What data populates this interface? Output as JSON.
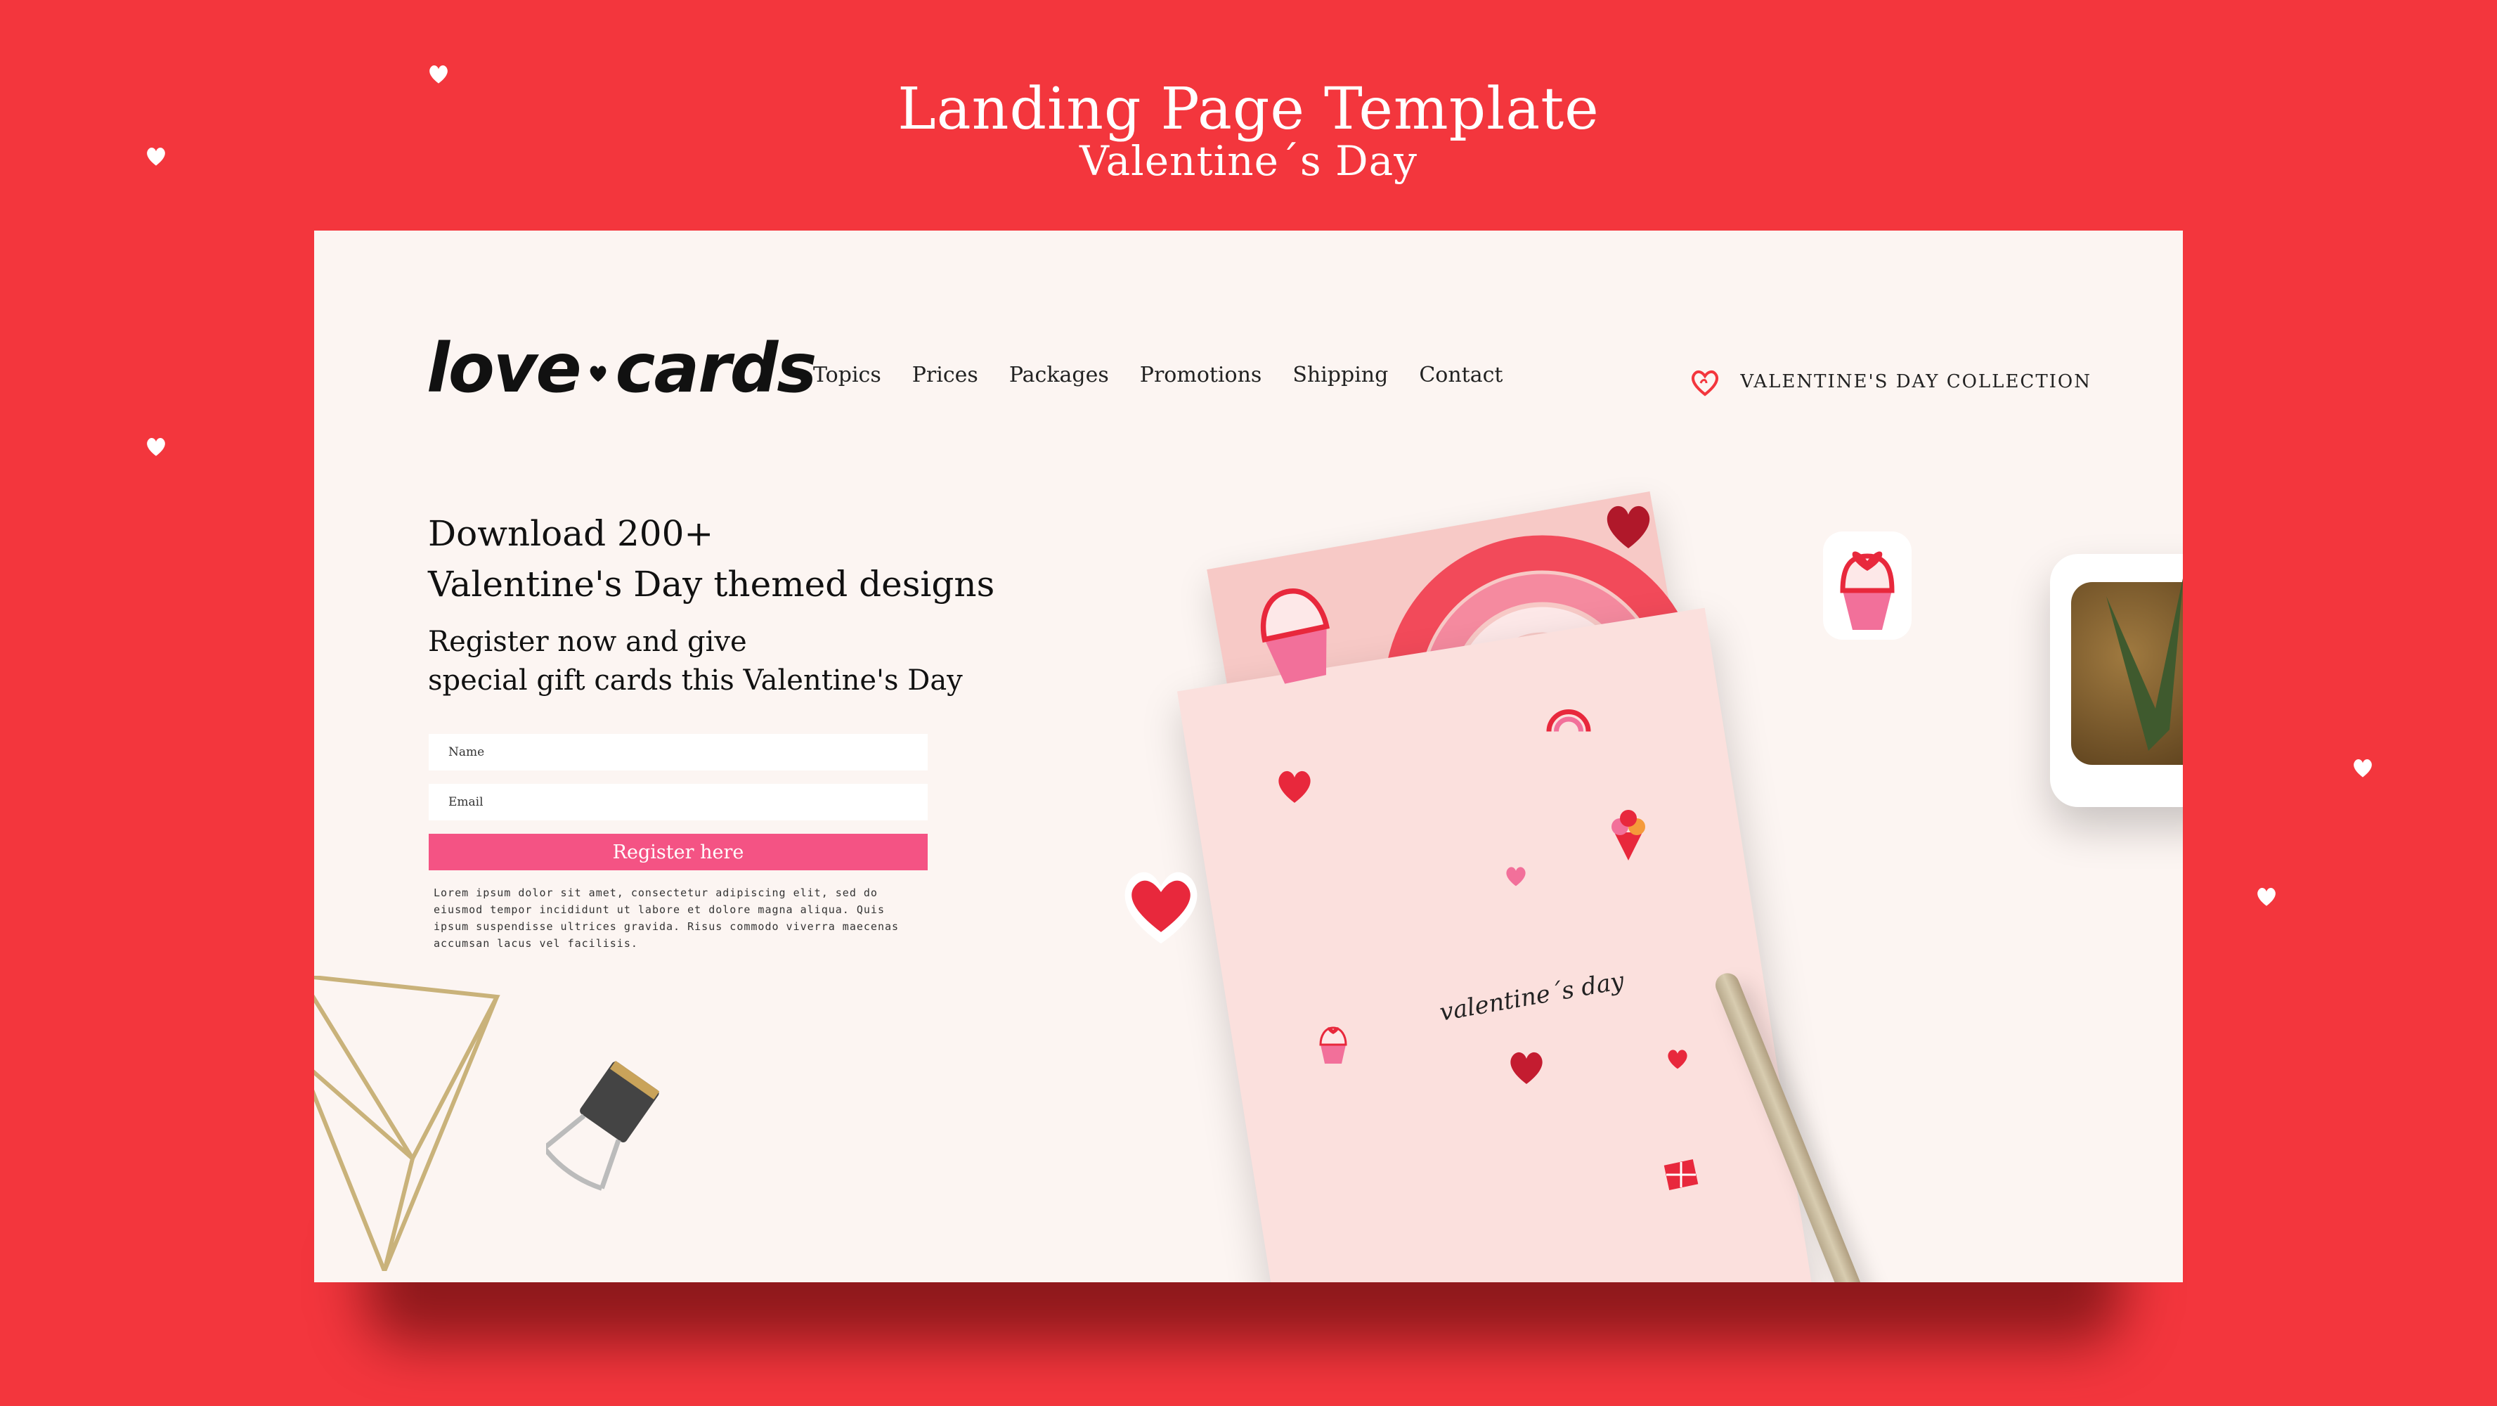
{
  "template_title": "Landing Page Template",
  "template_subtitle": "Valentine´s Day",
  "brand": {
    "word1": "love",
    "word2": "cards"
  },
  "nav": [
    "Topics",
    "Prices",
    "Packages",
    "Promotions",
    "Shipping",
    "Contact"
  ],
  "collection_label": "VALENTINE'S DAY COLLECTION",
  "hero": {
    "headline_line1": "Download 200+",
    "headline_line2": "Valentine's Day themed designs",
    "sub_line1": "Register now and give",
    "sub_line2": "special gift cards this Valentine's Day"
  },
  "form": {
    "name_placeholder": "Name",
    "email_placeholder": "Email",
    "register_label": "Register here"
  },
  "lorem": "Lorem ipsum dolor sit amet, consectetur adipiscing elit, sed do eiusmod tempor incididunt ut labore et dolore magna aliqua. Quis ipsum suspendisse ultrices gravida. Risus commodo viverra maecenas accumsan lacus vel facilisis.",
  "card_text": "valentine´s day",
  "colors": {
    "background": "#f3363d",
    "accent": "#f45384",
    "page": "#fcf5f2"
  }
}
